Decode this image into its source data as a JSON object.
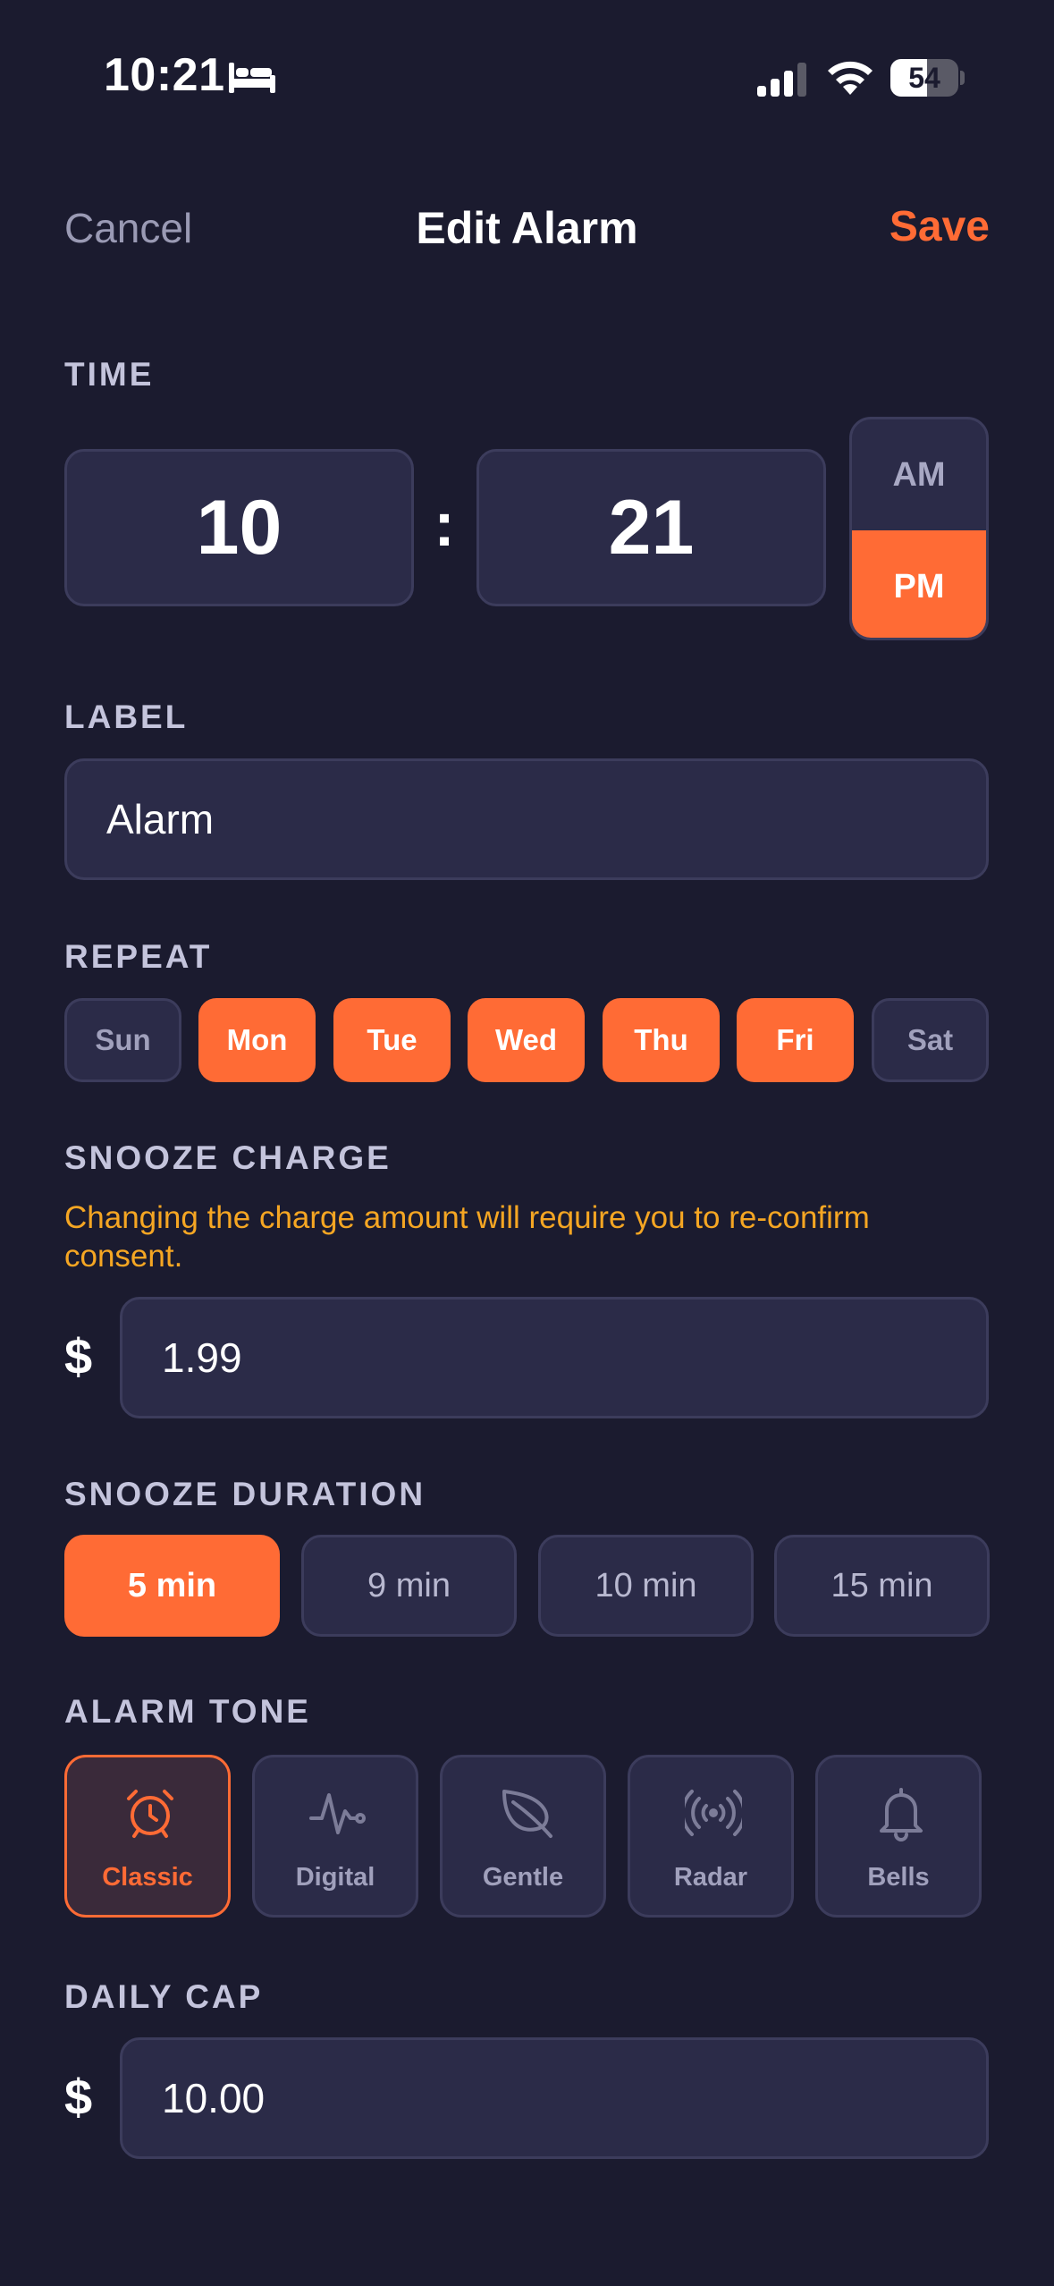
{
  "status": {
    "time": "10:21",
    "battery": "54",
    "battery_level": 0.54
  },
  "nav": {
    "cancel": "Cancel",
    "title": "Edit Alarm",
    "save": "Save"
  },
  "time": {
    "section": "TIME",
    "hour": "10",
    "colon": ":",
    "minute": "21",
    "am": "AM",
    "pm": "PM",
    "selected": "PM"
  },
  "label": {
    "section": "LABEL",
    "value": "Alarm"
  },
  "repeat": {
    "section": "REPEAT",
    "days": [
      {
        "label": "Sun",
        "selected": false
      },
      {
        "label": "Mon",
        "selected": true
      },
      {
        "label": "Tue",
        "selected": true
      },
      {
        "label": "Wed",
        "selected": true
      },
      {
        "label": "Thu",
        "selected": true
      },
      {
        "label": "Fri",
        "selected": true
      },
      {
        "label": "Sat",
        "selected": false
      }
    ]
  },
  "snooze_charge": {
    "section": "SNOOZE CHARGE",
    "warning": "Changing the charge amount will require you to re-confirm consent.",
    "currency": "$",
    "value": "1.99"
  },
  "snooze_duration": {
    "section": "SNOOZE DURATION",
    "options": [
      {
        "label": "5 min",
        "selected": true
      },
      {
        "label": "9 min",
        "selected": false
      },
      {
        "label": "10 min",
        "selected": false
      },
      {
        "label": "15 min",
        "selected": false
      }
    ]
  },
  "alarm_tone": {
    "section": "ALARM TONE",
    "tones": [
      {
        "label": "Classic",
        "icon": "alarm-clock-icon",
        "selected": true
      },
      {
        "label": "Digital",
        "icon": "pulse-icon",
        "selected": false
      },
      {
        "label": "Gentle",
        "icon": "leaf-icon",
        "selected": false
      },
      {
        "label": "Radar",
        "icon": "radar-icon",
        "selected": false
      },
      {
        "label": "Bells",
        "icon": "bell-icon",
        "selected": false
      }
    ]
  },
  "daily_cap": {
    "section": "DAILY CAP",
    "currency": "$",
    "value": "10.00"
  },
  "colors": {
    "accent": "#ff6b35",
    "warning": "#f5a623",
    "background": "#1b1b2f",
    "surface": "#2b2b48"
  }
}
